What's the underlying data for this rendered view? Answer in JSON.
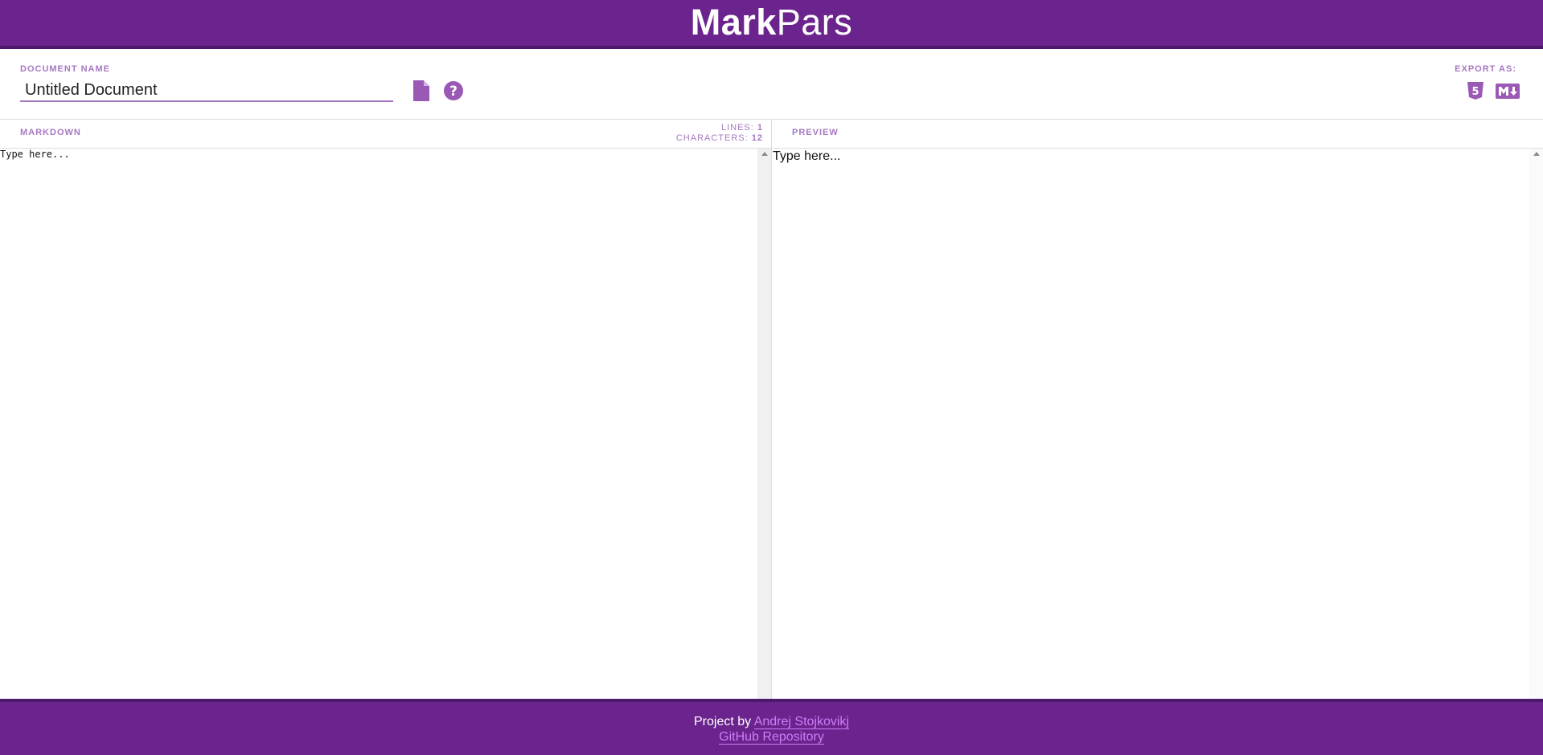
{
  "header": {
    "logo_bold": "Mark",
    "logo_light": "Pars"
  },
  "toolbar": {
    "document_name_label": "DOCUMENT NAME",
    "document_name_value": "Untitled Document",
    "new_document_icon": "file-icon",
    "help_icon": "question-circle-icon",
    "export_label": "EXPORT AS:",
    "export_html_icon": "html5-icon",
    "export_markdown_icon": "markdown-icon"
  },
  "markdown_pane": {
    "title": "MARKDOWN",
    "lines_label": "LINES:",
    "lines_value": "1",
    "characters_label": "CHARACTERS:",
    "characters_value": "12",
    "content": "Type here..."
  },
  "preview_pane": {
    "title": "PREVIEW",
    "content": "Type here..."
  },
  "footer": {
    "project_by": "Project by",
    "author_link": "Andrej Stojkovikj",
    "repo_link": "GitHub Repository"
  },
  "colors": {
    "brand": "#6b238e",
    "accent": "#a678c2",
    "link": "#cf7ef5",
    "icon": "#9b59b6"
  }
}
